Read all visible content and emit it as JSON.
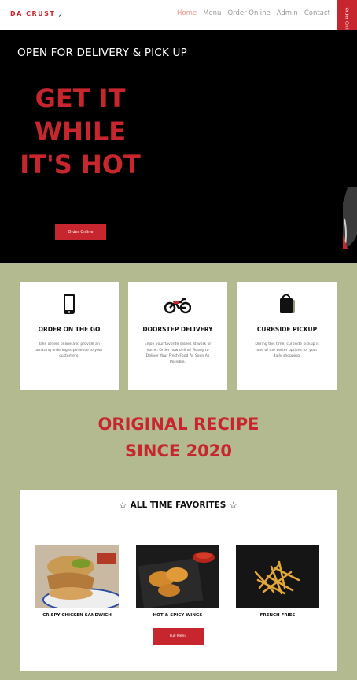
{
  "header": {
    "logo": "DA CRUST",
    "nav": [
      "Home",
      "Menu",
      "Order Online",
      "Admin",
      "Contact"
    ],
    "order_tab": "Order Online"
  },
  "hero": {
    "subtitle": "OPEN FOR DELIVERY & PICK UP",
    "title_lines": [
      "GET IT",
      "WHILE",
      "IT'S HOT"
    ],
    "button": "Order Online"
  },
  "features": [
    {
      "icon": "phone-icon",
      "title": "ORDER ON THE GO",
      "text": "Take orders online and provide an amazing ordering experience to your customers."
    },
    {
      "icon": "motorcycle-icon",
      "title": "DOORSTEP DELIVERY",
      "text": "Enjoy your favorite dishes at work or home. Order now online! Ready to Deliver Your Fresh Food As Soon As Possible."
    },
    {
      "icon": "bag-icon",
      "title": "CURBSIDE PICKUP",
      "text": "During this time, curbside pickup is one of the better options for your daily shopping."
    }
  ],
  "recipe": {
    "line1": "ORIGINAL RECIPE",
    "line2": "SINCE 2020"
  },
  "favorites": {
    "title": "ALL TIME FAVORITES",
    "items": [
      {
        "name": "CRISPY CHICKEN SANDWICH"
      },
      {
        "name": "HOT & SPICY WINGS"
      },
      {
        "name": "FRENCH FRIES"
      }
    ],
    "button": "Full Menu"
  },
  "colors": {
    "accent": "#c7262e",
    "background": "#b3ba8f"
  }
}
